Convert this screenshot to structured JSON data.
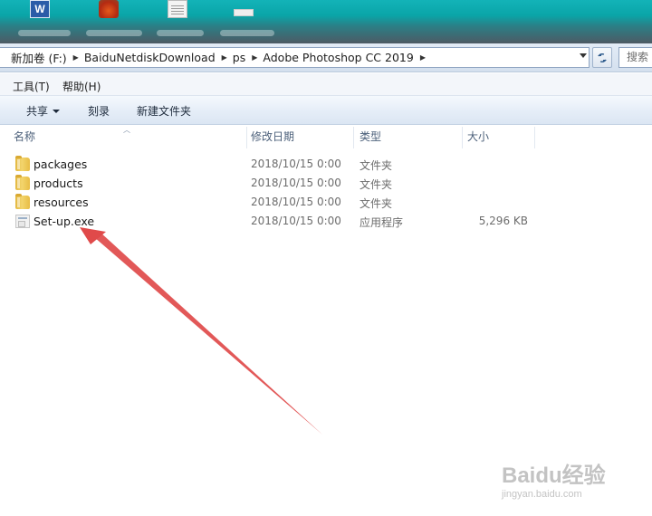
{
  "desktop": {
    "icons": [
      "word-icon",
      "app-icon",
      "document-icon",
      "blank-icon"
    ],
    "word_letter": "W"
  },
  "address_bar": {
    "breadcrumbs": [
      "新加卷 (F:)",
      "BaiduNetdiskDownload",
      "ps",
      "Adobe Photoshop CC 2019"
    ],
    "search_placeholder": "搜索"
  },
  "menu": {
    "items": [
      "工具(T)",
      "帮助(H)"
    ]
  },
  "toolbar": {
    "share_label": "共享",
    "burn_label": "刻录",
    "new_folder_label": "新建文件夹"
  },
  "columns": {
    "name": "名称",
    "date": "修改日期",
    "type": "类型",
    "size": "大小"
  },
  "files": [
    {
      "name": "packages",
      "date": "2018/10/15 0:00",
      "type": "文件夹",
      "size": "",
      "icon": "folder-icon"
    },
    {
      "name": "products",
      "date": "2018/10/15 0:00",
      "type": "文件夹",
      "size": "",
      "icon": "folder-icon"
    },
    {
      "name": "resources",
      "date": "2018/10/15 0:00",
      "type": "文件夹",
      "size": "",
      "icon": "folder-icon"
    },
    {
      "name": "Set-up.exe",
      "date": "2018/10/15 0:00",
      "type": "应用程序",
      "size": "5,296 KB",
      "icon": "application-icon"
    }
  ],
  "colors": {
    "annotation_arrow": "#e04a4a",
    "desktop_accent": "#13b3b8"
  },
  "watermark": {
    "main": "Baidu经验",
    "sub": "jingyan.baidu.com"
  }
}
